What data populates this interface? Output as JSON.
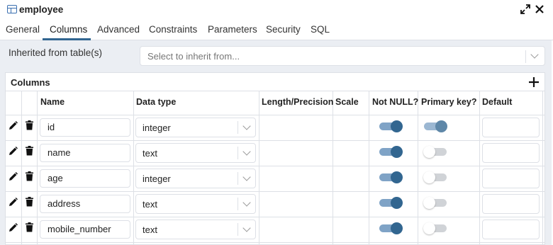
{
  "window": {
    "title": "employee"
  },
  "tabs": [
    "General",
    "Columns",
    "Advanced",
    "Constraints",
    "Parameters",
    "Security",
    "SQL"
  ],
  "active_tab": "Columns",
  "inherit": {
    "label": "Inherited from table(s)",
    "placeholder": "Select to inherit from..."
  },
  "columns_panel": {
    "title": "Columns",
    "headers": {
      "name": "Name",
      "data_type": "Data type",
      "length": "Length/Precision",
      "scale": "Scale",
      "not_null": "Not NULL?",
      "primary_key": "Primary key?",
      "default": "Default"
    },
    "rows": [
      {
        "name": "id",
        "data_type": "integer",
        "not_null": true,
        "primary_key": true
      },
      {
        "name": "name",
        "data_type": "text",
        "not_null": true,
        "primary_key": false
      },
      {
        "name": "age",
        "data_type": "integer",
        "not_null": true,
        "primary_key": false
      },
      {
        "name": "address",
        "data_type": "text",
        "not_null": true,
        "primary_key": false
      },
      {
        "name": "mobile_number",
        "data_type": "text",
        "not_null": true,
        "primary_key": false
      }
    ]
  },
  "icons": {
    "table": "table-icon",
    "expand": "expand-icon",
    "close": "close-icon",
    "add": "plus-icon",
    "edit": "pencil-icon",
    "delete": "trash-icon",
    "dropdown": "chevron-down-icon"
  },
  "colors": {
    "accent": "#326690",
    "toggle_on_track": "#7fa3c6",
    "toggle_off_track": "#c4c7cc",
    "border": "#dde0e6",
    "background": "#ebeef3"
  }
}
